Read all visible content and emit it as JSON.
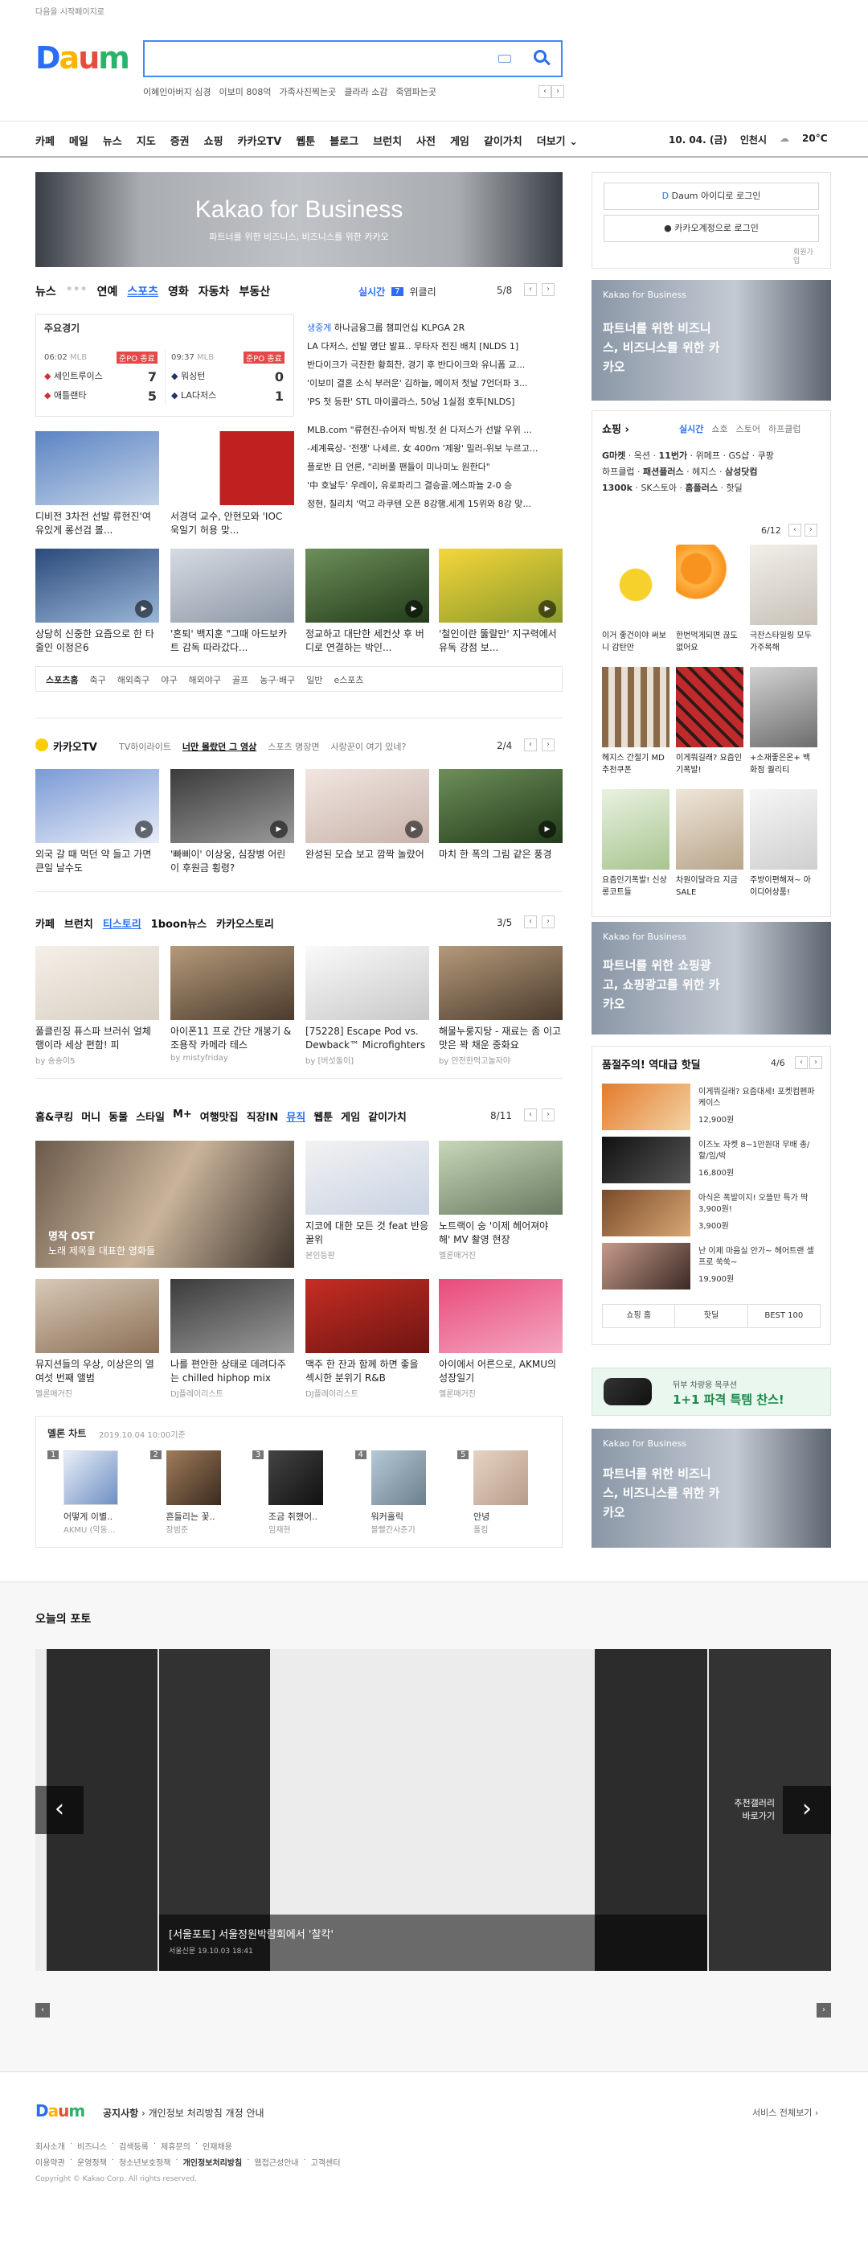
{
  "top": {
    "set_home": "다음을 시작페이지로"
  },
  "logo": {
    "text": "Daum"
  },
  "search": {
    "value": "",
    "keywords": [
      "이혜인아버지 심경",
      "이보미 808억",
      "가족사진찍는곳",
      "클라라 소감",
      "죽염파는곳"
    ]
  },
  "gnb": {
    "items": [
      "카페",
      "메일",
      "뉴스",
      "지도",
      "증권",
      "쇼핑",
      "카카오TV",
      "웹툰",
      "블로그",
      "브런치",
      "사전",
      "게임",
      "같이가치",
      "더보기"
    ],
    "date": "10. 04. (금)",
    "location": "인천시",
    "weather": "20°C"
  },
  "banner": {
    "title": "Kakao for Business",
    "sub": "파트너를 위한 비즈니스, 비즈니스를 위한 카카오"
  },
  "login": {
    "daum": "Daum 아이디로 로그인",
    "kakao": "카카오계정으로 로그인",
    "join": "회원가입"
  },
  "news": {
    "tabs": [
      "뉴스",
      "연예",
      "스포츠",
      "영화",
      "자동차",
      "부동산"
    ],
    "live": "실시간",
    "live_num": "7",
    "weekly": "위클리",
    "page": "5/8",
    "score": {
      "title": "주요경기",
      "g1": {
        "time": "06:02",
        "league": "MLB",
        "status": "준PO 종료",
        "t1": "세인트루이스",
        "s1": "7",
        "t2": "애틀랜타",
        "s2": "5"
      },
      "g2": {
        "time": "09:37",
        "league": "MLB",
        "status": "준PO 종료",
        "t1": "워싱턴",
        "s1": "0",
        "t2": "LA다저스",
        "s2": "1"
      }
    },
    "headlines": [
      {
        "tag": "생중계",
        "text": "하나금융그룹 챔피언십 KLPGA 2R"
      },
      {
        "tag": "",
        "text": "LA 다저스, 선발 명단 발표.. 무타자 전진 배치 [NLDS 1]"
      },
      {
        "tag": "",
        "text": "반다이크가 극찬한 황희찬, 경기 후 반다이크와 유니폼 교..."
      },
      {
        "tag": "",
        "text": "'이보미 결혼 소식 부러운' 김하늘, 메이저 첫날 7언더파 3..."
      },
      {
        "tag": "",
        "text": "'PS 첫 등판' STL 마이콜라스, 50닝 1실점 호투[NLDS]"
      },
      {
        "tag": "",
        "text": "MLB.com \"류현진-슈어저 박빙.첫 쉰 다저스가 선발 우위 ..."
      },
      {
        "tag": "",
        "text": "-세계육상- '전쟁' 나세르, 女 400m '제왕' 밀러-위보 누르고..."
      },
      {
        "tag": "",
        "text": "플로반 日 언론, \"리버풀 팬들이 미나미노 원한다\""
      },
      {
        "tag": "",
        "text": "'中 호날두' 우레이, 유로파리그 결승골.에스파뇰 2-0 승"
      },
      {
        "tag": "",
        "text": "정현, 칠리치 '먹고 라쿠텐 오픈 8강행.세계 15위와 8강 맞..."
      }
    ],
    "photos": [
      {
        "cap": "디비전 3차전 선발 류현진'여유있게 롱선검 볼..."
      },
      {
        "cap": "서경덕 교수, 안현모와 'IOC 욱일기 허용 맞..."
      },
      {
        "cap": "상당히 신중한 요즘으로 한 타 줄인 이정은6"
      },
      {
        "cap": "'흔퇴' 백지훈 \"그때 아드보카트 감독 따라갔다..."
      },
      {
        "cap": "정교하고 대단한 세컨샷 후 버디로 연결하는 박인..."
      },
      {
        "cap": "'철인이란 뚫랄만' 지구력에서 유독 강점 보..."
      }
    ],
    "sports_links": [
      "스포츠홈",
      "축구",
      "해외축구",
      "야구",
      "해외야구",
      "골프",
      "농구·배구",
      "일반",
      "e스포츠"
    ]
  },
  "kakaotv": {
    "title": "카카오TV",
    "tabs": [
      "TV하이라이트",
      "너만 몰랐던 그 영상",
      "스포츠 명장면",
      "사랑꾼이 여기 있네?"
    ],
    "page": "2/4",
    "items": [
      {
        "cap": "외국 갈 때 먹던 약 들고 가면 큰일 날수도"
      },
      {
        "cap": "'빠삐이' 이상웅, 심장병 어린이 후원금 횡령?"
      },
      {
        "cap": "완성된 모습 보고 깜짝 놀랐어"
      },
      {
        "cap": "마치 한 폭의 그림 같은 풍경"
      }
    ]
  },
  "cafe": {
    "tabs": [
      "카페",
      "브런치",
      "티스토리",
      "1boon뉴스",
      "카카오스토리"
    ],
    "page": "3/5",
    "items": [
      {
        "cap": "풀클린징 퓨스파 브러쉬 얼체행이라 세상 편함! 피",
        "by": "by 숑숑이5"
      },
      {
        "cap": "아이폰11 프로 간단 개봉기 & 조용작 카메라 테스",
        "by": "by mistyfriday"
      },
      {
        "cap": "[75228] Escape Pod vs. Dewback™ Microfighters /",
        "by": "by [버섯돌이]"
      },
      {
        "cap": "해물누룽지탕 - 재료는 좀 이고 맛은 꽉 채운 중화요",
        "by": "by 안전한먹고놀자야"
      }
    ]
  },
  "home": {
    "tabs": [
      "홈&쿠킹",
      "머니",
      "동물",
      "스타일",
      "M+",
      "여행맛집",
      "직장IN",
      "뮤직",
      "웹툰",
      "게임",
      "같이가치"
    ],
    "page": "8/11",
    "main_cap1": "명작 OST",
    "main_cap2": "노래 제목을 대표한 영화들",
    "items": [
      {
        "cap": "지코에 대한 모든 것 feat 반응 꿀위",
        "by": "본인등판"
      },
      {
        "cap": "노트랙이 숭 '이제 헤어져야 해' MV 촬영 현장",
        "by": "멜론매거진"
      },
      {
        "cap": "뮤지션들의 우상, 이상은의 열여섯 번째 앨범",
        "by": "멜론매거진"
      },
      {
        "cap": "나를 편안한 상태로 데려다주는 chilled hiphop mix",
        "by": "DJ플레이리스트"
      },
      {
        "cap": "맥주 한 잔과 함께 하면 좋을 섹시한 분위기 R&B",
        "by": "DJ플레이리스트"
      },
      {
        "cap": "아이에서 어른으로, AKMU의 성장일기",
        "by": "멜론매거진"
      }
    ],
    "chart_title": "멜론 차트",
    "chart_time": "2019.10.04 10:00기준",
    "chart": [
      {
        "rank": "1",
        "song": "어떻게 이별..",
        "artist": "AKMU (악동..."
      },
      {
        "rank": "2",
        "song": "흔들리는 꽃..",
        "artist": "장범준"
      },
      {
        "rank": "3",
        "song": "조금 취했어..",
        "artist": "임재현"
      },
      {
        "rank": "4",
        "song": "워커홀릭",
        "artist": "볼빨간사춘기"
      },
      {
        "rank": "5",
        "song": "안녕",
        "artist": "폴킴"
      }
    ]
  },
  "right": {
    "ad_title": "Kakao for Business",
    "ad_text": "파트너를 위한 비즈니스, 비즈니스를 위한 카카오",
    "shop_title": "쇼핑",
    "shop_tabs": [
      "실시간",
      "쇼호",
      "스토어",
      "하프클럽"
    ],
    "shop_links": [
      [
        "G마켓",
        "옥션",
        "11번가",
        "위메프",
        "GS샵",
        "쿠팡"
      ],
      [
        "하프클럽",
        "패션플러스",
        "헤지스",
        "삼성닷컴"
      ],
      [
        "1300k",
        "SK스토아",
        "홈플러스",
        "핫딜"
      ]
    ],
    "shop_page": "6/12",
    "shop_items": [
      {
        "cap": "이거 좋건이야 써보니 감탄만"
      },
      {
        "cap": "한번먹게되면 끊도없어요"
      },
      {
        "cap": "극잔스타일링 모두가주목해"
      },
      {
        "cap": "헤지스 간절기 MD추천쿠폰"
      },
      {
        "cap": "이게뭐길래? 요즘인기폭발!"
      },
      {
        "cap": "+소재좋은온+ 백화점 퀄리티"
      },
      {
        "cap": "요즘인기폭발! 신상롱코트들"
      },
      {
        "cap": "차원이달라요 지금 SALE"
      },
      {
        "cap": "주방이편해져~ 아이디어상품!"
      }
    ],
    "ad2_title": "Kakao for Business",
    "ad2_text": "파트너를 위한 쇼핑광고, 쇼핑광고를 위한 카카오",
    "hot_title": "품절주의! 역대급 핫딜",
    "hot_page": "4/6",
    "hot": [
      {
        "cap": "이게뭐길래? 요즘대세! 포켓컴펜파케이스",
        "price": "12,900원"
      },
      {
        "cap": "이즈노 자켓 8~1만원대 무배 총/할/임/박",
        "price": "16,800원"
      },
      {
        "cap": "아식은 폭발이지! 오뜰만 특가 딱3,900원!",
        "price": "3,900원"
      },
      {
        "cap": "난 이제 마음실 안가~ 헤어트랜 셀프로 쑥쑥~",
        "price": "19,900원"
      }
    ],
    "hot_tabs": [
      "쇼핑 홈",
      "핫딜",
      "BEST 100"
    ],
    "promo_line1": "뒤부 차량용 목쿠션",
    "promo_line2": "1+1 파격 특템 찬스!",
    "ad3_title": "Kakao for Business",
    "ad3_text": "파트너를 위한 비즈니스, 비즈니스를 위한 카카오"
  },
  "photo": {
    "title": "오늘의 포토",
    "caption": "[서울포토] 서울정원박람회에서 '찰칵'",
    "source": "서울신문",
    "time": "19.10.03 18:41",
    "right_label1": "추천갤러리",
    "right_label2": "바로가기"
  },
  "footer": {
    "notice": "공지사항",
    "notice_text": "개인정보 처리방침 개정 안내",
    "all": "서비스 전체보기",
    "row1": [
      "회사소개",
      "비즈니스",
      "검색등록",
      "제휴문의",
      "인재채용"
    ],
    "row2": [
      "이용약관",
      "운영정책",
      "청소년보호정책",
      "개인정보처리방침",
      "웹접근성안내",
      "고객센터"
    ],
    "copy": "Copyright © Kakao Corp. All rights reserved."
  }
}
